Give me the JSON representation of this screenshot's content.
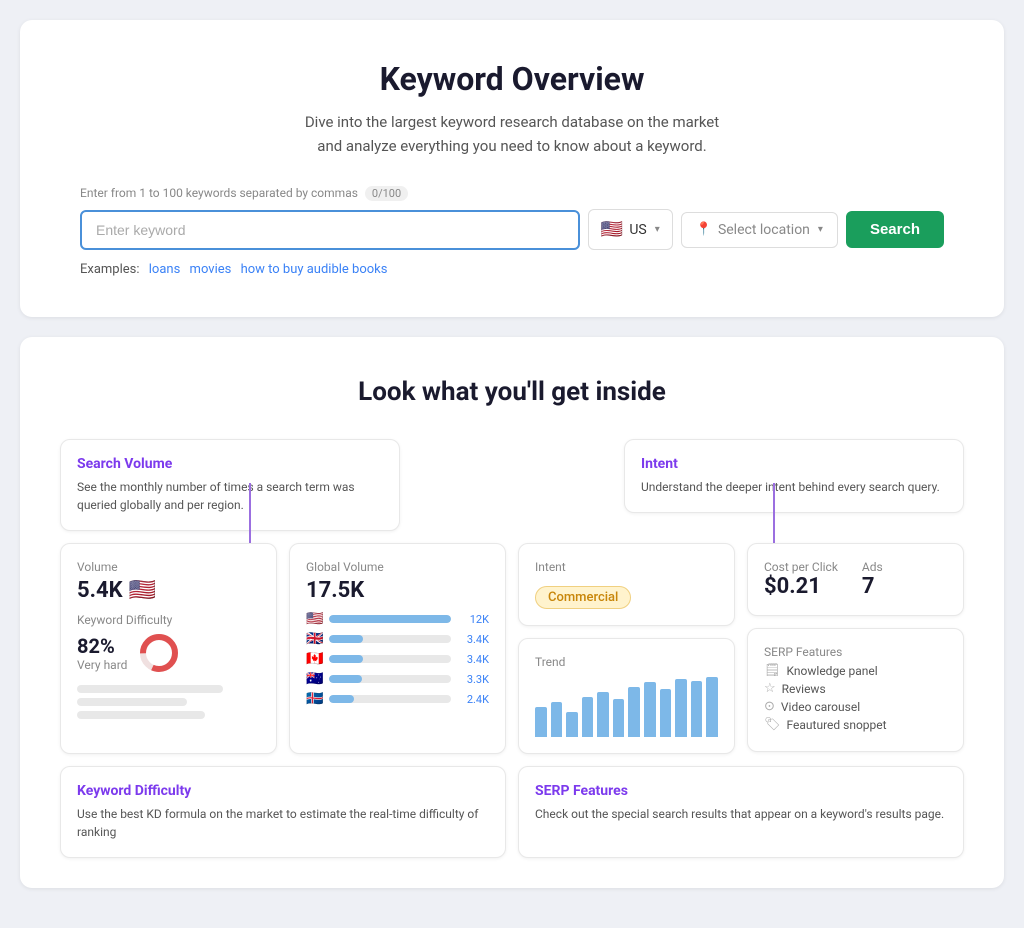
{
  "hero": {
    "title": "Keyword Overview",
    "subtitle_line1": "Dive into the largest keyword research database on the market",
    "subtitle_line2": "and analyze everything you need to know about a keyword.",
    "input_label": "Enter from 1 to 100 keywords separated by commas",
    "input_count": "0/100",
    "input_placeholder": "Enter keyword",
    "country_code": "US",
    "location_placeholder": "Select location",
    "search_button": "Search",
    "examples_label": "Examples:",
    "examples": [
      "loans",
      "movies",
      "how to buy audible books"
    ]
  },
  "preview": {
    "section_title": "Look what you'll get inside",
    "tooltip_search_volume": {
      "title": "Search Volume",
      "text": "See the monthly number of times a search term was queried globally and per region."
    },
    "tooltip_intent": {
      "title": "Intent",
      "text": "Understand the deeper intent behind every search query."
    },
    "volume_card": {
      "label": "Volume",
      "value": "5.4K",
      "kd_label": "Keyword Difficulty",
      "kd_value": "82%",
      "kd_sub": "Very hard"
    },
    "global_volume_card": {
      "label": "Global Volume",
      "value": "17.5K",
      "bars": [
        {
          "flag": "🇺🇸",
          "pct": 100,
          "val": "12K"
        },
        {
          "flag": "🇬🇧",
          "pct": 28,
          "val": "3.4K"
        },
        {
          "flag": "🇨🇦",
          "pct": 28,
          "val": "3.4K"
        },
        {
          "flag": "🇦🇺",
          "pct": 27,
          "val": "3.3K"
        },
        {
          "flag": "🇮🇸",
          "pct": 20,
          "val": "2.4K"
        }
      ]
    },
    "intent_card": {
      "label": "Intent",
      "badge": "Commercial"
    },
    "trend_card": {
      "label": "Trend",
      "bars": [
        30,
        35,
        25,
        40,
        45,
        38,
        50,
        55,
        48,
        60,
        58,
        65
      ]
    },
    "cpc_card": {
      "cpc_label": "Cost per Click",
      "cpc_value": "$0.21",
      "ads_label": "Ads",
      "ads_value": "7"
    },
    "serp_card": {
      "label": "SERP Features",
      "items": [
        "Knowledge panel",
        "Reviews",
        "Video carousel",
        "Feautured snoppet"
      ]
    },
    "tooltip_kd": {
      "title": "Keyword Difficulty",
      "text": "Use the best KD formula on the market to estimate the real-time difficulty of ranking"
    },
    "tooltip_serp": {
      "title": "SERP Features",
      "text": "Check out the special search results that appear on a keyword's results page."
    }
  }
}
